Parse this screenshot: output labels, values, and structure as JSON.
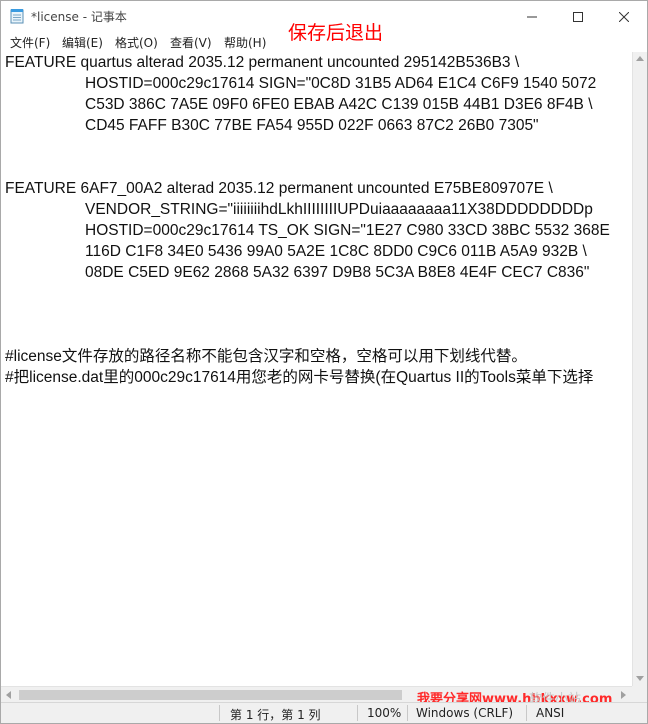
{
  "window": {
    "title": "*license - 记事本",
    "annotation": "保存后退出"
  },
  "menu": [
    "文件(F)",
    "编辑(E)",
    "格式(O)",
    "查看(V)",
    "帮助(H)"
  ],
  "editor": {
    "lines": [
      "FEATURE quartus alterad 2035.12 permanent uncounted 295142B536B3 \\",
      "HOSTID=000c29c17614 SIGN=\"0C8D 31B5 AD64 E1C4 C6F9 1540 5072",
      "C53D 386C 7A5E 09F0 6FE0 EBAB A42C C139 015B 44B1 D3E6 8F4B \\",
      "CD45 FAFF B30C 77BE FA54 955D 022F 0663 87C2 26B0 7305\"",
      "FEATURE 6AF7_00A2 alterad 2035.12 permanent uncounted E75BE809707E \\",
      "VENDOR_STRING=\"iiiiiiiihdLkhIIIIIIIIUPDuiaaaaaaaa11X38DDDDDDDDp",
      "HOSTID=000c29c17614 TS_OK SIGN=\"1E27 C980 33CD 38BC 5532 368E",
      "116D C1F8 34E0 5436 99A0 5A2E 1C8C 8DD0 C9C6 011B A5A9 932B \\",
      "08DE C5ED 9E62 2868 5A32 6397 D9B8 5C3A B8E8 4E4F CEC7 C836\"",
      "#license文件存放的路径名称不能包含汉字和空格，空格可以用下划线代替。",
      "#把license.dat里的000c29c17614用您老的网卡号替换(在Quartus II的Tools菜单下选择"
    ]
  },
  "statusbar": {
    "position": "第 1 行，第 1 列",
    "zoom": "100%",
    "line_ending": "Windows (CRLF)",
    "encoding": "ANSI"
  },
  "watermark": {
    "text": "我要分享网www.hhkxxw.com",
    "text2": "软件小站"
  }
}
